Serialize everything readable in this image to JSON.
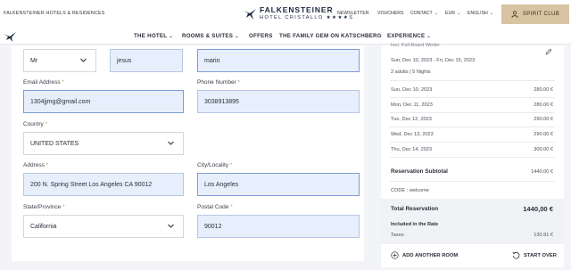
{
  "header": {
    "group_name": "FALKENSTEINER HOTELS & RESIDENCES",
    "logo_line1": "FALKENSTEINER",
    "logo_line2": "HOTEL CRISTALLO ★★★★S",
    "links": [
      "NEWSLETTER",
      "VOUCHERS",
      "CONTACT",
      "EUR",
      "ENGLISH"
    ],
    "spirit_club": "SPIRIT CLUB"
  },
  "nav": {
    "items": [
      "THE HOTEL",
      "ROOMS & SUITES",
      "OFFERS",
      "THE FAMILY GEM ON KATSCHBERG",
      "EXPERIENCE"
    ]
  },
  "form": {
    "salutation": "Mr",
    "first_name": "jesus",
    "last_name": "marin",
    "email_label": "Email Address",
    "email_value": "1304jjmg@gmail.com",
    "phone_label": "Phone Number",
    "phone_value": "3038913895",
    "country_label": "Country",
    "country_value": "UNITED STATES",
    "address_label": "Address",
    "address_value": "200 N. Spring Street Los Angeles CA 90012",
    "city_label": "City/Locality",
    "city_value": "Los Angeles",
    "state_label": "State/Province",
    "state_value": "California",
    "postal_label": "Postal Code",
    "postal_value": "90012",
    "required_mark": "*"
  },
  "summary": {
    "top_cut": "Incl. Full Board Winter",
    "date_range": "Sun, Dec 10, 2023 - Fri, Dec 15, 2023",
    "guests": "2 adults",
    "nights": "5 Nights",
    "nights_rows": [
      {
        "date": "Sun, Dec 10, 2023",
        "amount": "280.00 €"
      },
      {
        "date": "Mon, Dec 11, 2023",
        "amount": "280.00 €"
      },
      {
        "date": "Tue, Dec 12, 2023",
        "amount": "290.00 €"
      },
      {
        "date": "Wed, Dec 13, 2023",
        "amount": "290.00 €"
      },
      {
        "date": "Thu, Dec 14, 2023",
        "amount": "300.00 €"
      }
    ],
    "subtotal_label": "Reservation Subtotal",
    "subtotal_value": "1440.00 €",
    "code_text": "CODE : welcome",
    "total_label": "Total Reservation",
    "total_value": "1440,00 €",
    "included_label": "Included in the Rate",
    "taxes_label": "Taxes",
    "taxes_value": "130.91 €",
    "add_room": "ADD ANOTHER ROOM",
    "start_over": "START OVER"
  }
}
